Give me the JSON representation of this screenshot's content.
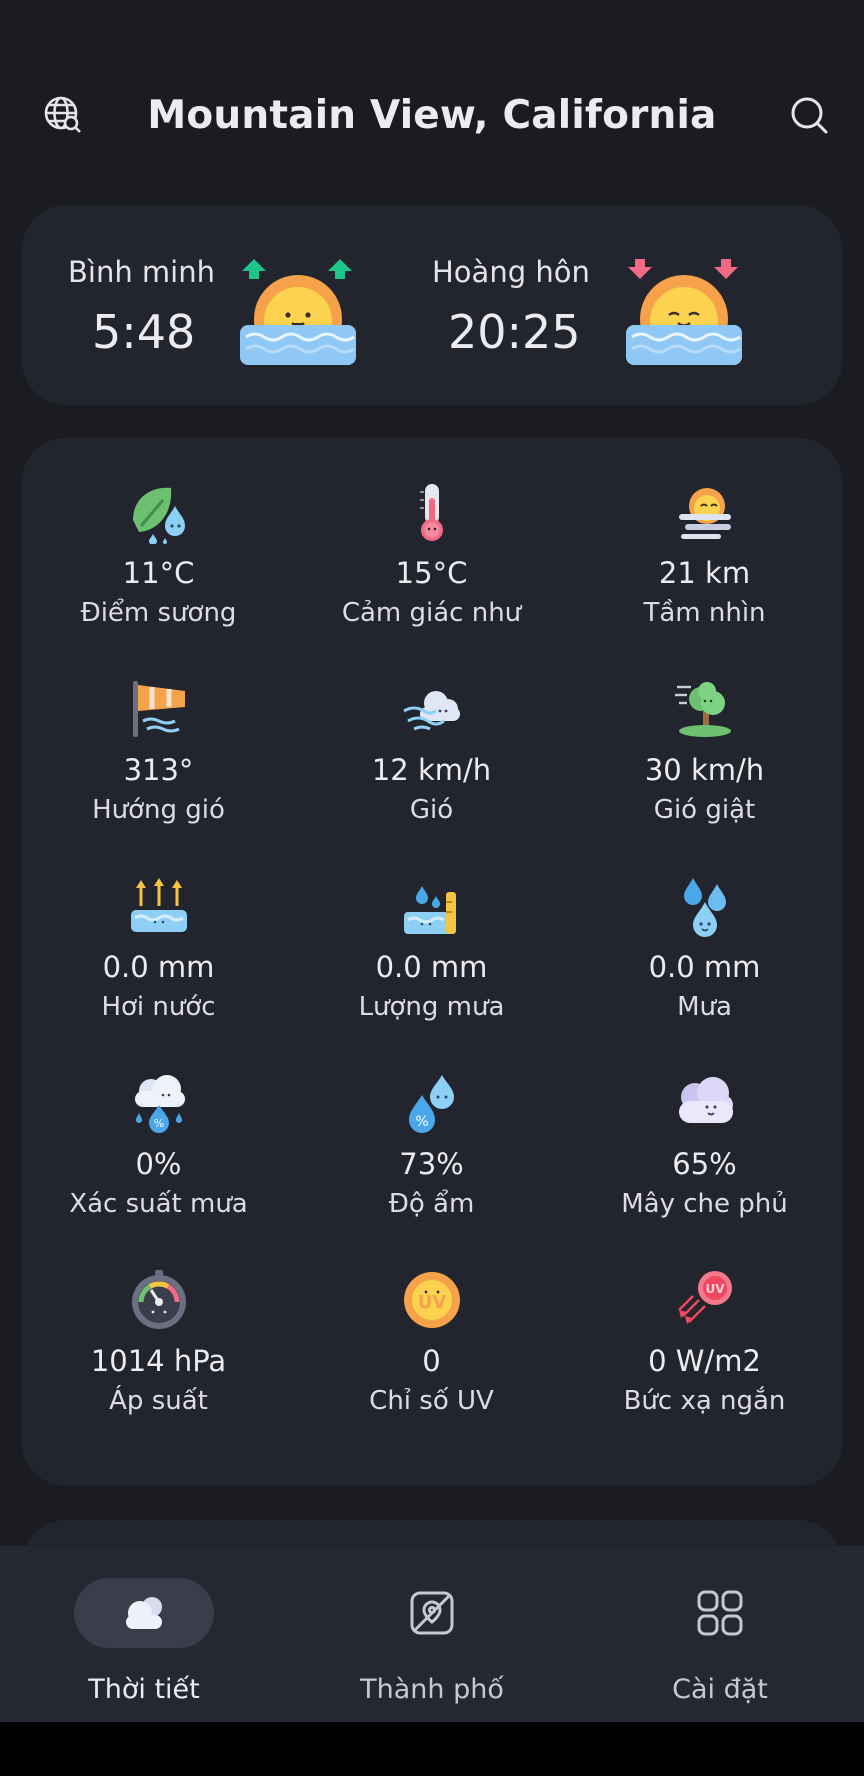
{
  "header": {
    "title": "Mountain View, California",
    "left_icon": "globe-search-icon",
    "right_icon": "search-icon"
  },
  "sun": {
    "sunrise_label": "Bình minh",
    "sunrise_time": "5:48",
    "sunset_label": "Hoàng hôn",
    "sunset_time": "20:25"
  },
  "details": [
    {
      "value": "11°C",
      "label": "Điểm sương",
      "icon": "dew-point-icon"
    },
    {
      "value": "15°C",
      "label": "Cảm giác như",
      "icon": "thermometer-icon"
    },
    {
      "value": "21 km",
      "label": "Tầm nhìn",
      "icon": "visibility-icon"
    },
    {
      "value": "313°",
      "label": "Hướng gió",
      "icon": "windsock-icon"
    },
    {
      "value": "12 km/h",
      "label": "Gió",
      "icon": "wind-icon"
    },
    {
      "value": "30 km/h",
      "label": "Gió giật",
      "icon": "wind-gust-icon"
    },
    {
      "value": "0.0 mm",
      "label": "Hơi nước",
      "icon": "evaporation-icon"
    },
    {
      "value": "0.0 mm",
      "label": "Lượng mưa",
      "icon": "rain-gauge-icon"
    },
    {
      "value": "0.0 mm",
      "label": "Mưa",
      "icon": "raindrops-icon"
    },
    {
      "value": "0%",
      "label": "Xác suất mưa",
      "icon": "rain-probability-icon"
    },
    {
      "value": "73%",
      "label": "Độ ẩm",
      "icon": "humidity-icon"
    },
    {
      "value": "65%",
      "label": "Mây che phủ",
      "icon": "cloud-cover-icon"
    },
    {
      "value": "1014 hPa",
      "label": "Áp suất",
      "icon": "pressure-gauge-icon"
    },
    {
      "value": "0",
      "label": "Chỉ số UV",
      "icon": "uv-index-icon"
    },
    {
      "value": "0 W/m2",
      "label": "Bức xạ ngắn",
      "icon": "shortwave-radiation-icon"
    }
  ],
  "nav": {
    "weather": "Thời tiết",
    "cities": "Thành phố",
    "settings": "Cài đặt"
  },
  "colors": {
    "background": "#1b1c22",
    "card": "#23252e",
    "nav_bar": "#252732",
    "active_pill": "#3a3d4a",
    "sunrise_arrow": "#1ec58a",
    "sunset_arrow": "#f06a86"
  }
}
